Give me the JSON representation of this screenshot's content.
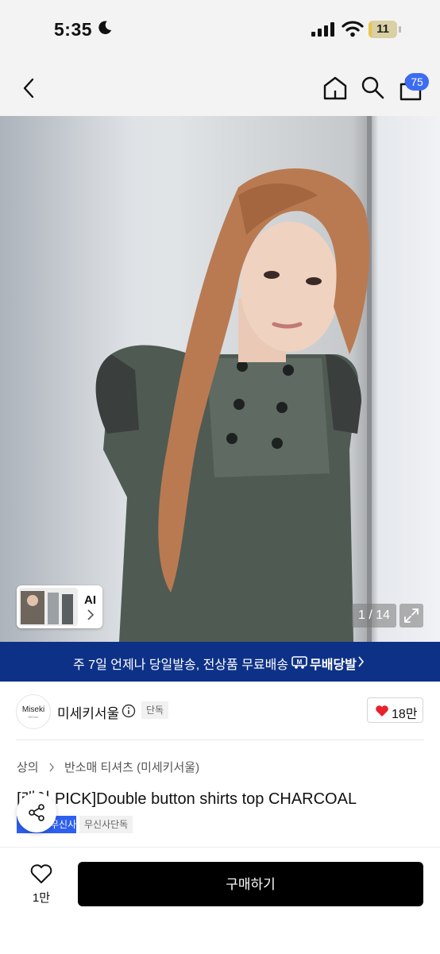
{
  "status_bar": {
    "time": "5:35",
    "battery": "11",
    "battery_level": 0.11,
    "moon_icon": "moon-icon",
    "signal_icon": "cellular-signal-icon",
    "wifi_icon": "wifi-icon"
  },
  "nav": {
    "back_icon": "chevron-left-icon",
    "home_icon": "home-icon",
    "search_icon": "search-icon",
    "cart_icon": "shopping-bag-icon",
    "cart_count": "75",
    "cart_badge_color": "#3d6cf4"
  },
  "hero": {
    "counter": "1 / 14",
    "thumbnail_label": "AI",
    "expand_icon": "expand-icon"
  },
  "promo": {
    "text": "주 7일 언제나 당일발송, 전상품 무료배송",
    "brand": "무배당발",
    "background": "#0e3188"
  },
  "brand": {
    "logo_text": "Miseki",
    "logo_sub": "SEOUL",
    "name": "미세키서울",
    "badge": "단독",
    "like_count": "18만"
  },
  "breadcrumb": {
    "category": "상의",
    "subcategory": "반소매 티셔츠 (미세키서울)"
  },
  "product": {
    "title": "[래이 PICK]Double button shirts top CHARCOAL",
    "tags": {
      "blue": "무신사 스타",
      "gray": "무신사단독"
    }
  },
  "bottom": {
    "wish_count": "1만",
    "buy_label": "구매하기"
  }
}
